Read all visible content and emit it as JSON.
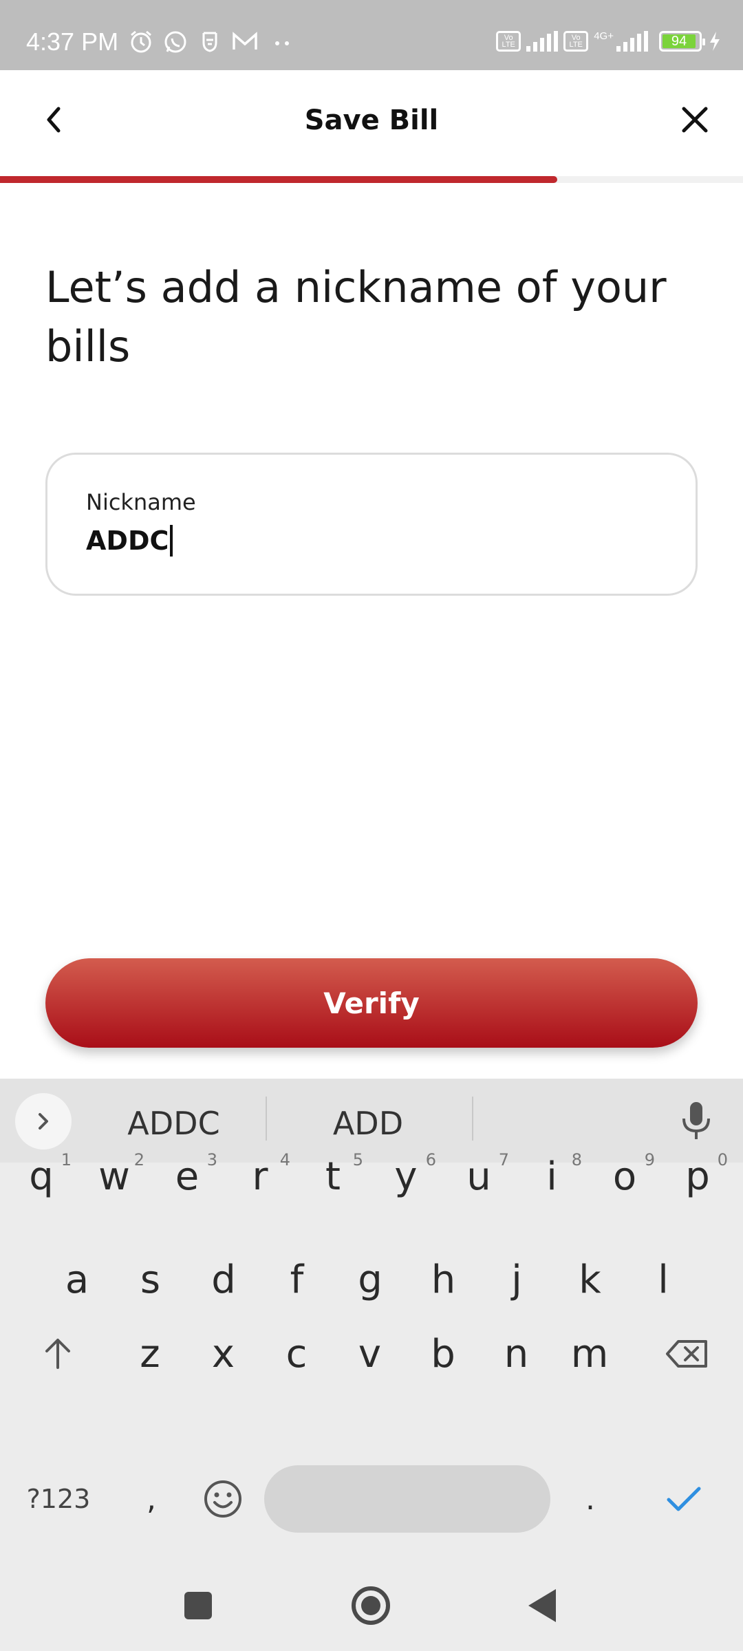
{
  "status_bar": {
    "time": "4:37 PM",
    "left_icons": [
      "alarm-icon",
      "whatsapp-icon",
      "app-icon",
      "gmail-icon",
      "more-dots-icon"
    ],
    "volte_label": "Vo LTE",
    "network_tag": "4G+",
    "battery_level": "94"
  },
  "header": {
    "title": "Save Bill",
    "back_icon": "chevron-left-icon",
    "close_icon": "close-icon",
    "progress_fraction": 0.75
  },
  "content": {
    "heading": "Let’s add a nickname of your bills",
    "nickname_field": {
      "label": "Nickname",
      "value": "ADDC"
    },
    "verify_label": "Verify"
  },
  "keyboard": {
    "suggestions": [
      "ADDC",
      "ADD"
    ],
    "row1": [
      {
        "k": "q",
        "n": "1"
      },
      {
        "k": "w",
        "n": "2"
      },
      {
        "k": "e",
        "n": "3"
      },
      {
        "k": "r",
        "n": "4"
      },
      {
        "k": "t",
        "n": "5"
      },
      {
        "k": "y",
        "n": "6"
      },
      {
        "k": "u",
        "n": "7"
      },
      {
        "k": "i",
        "n": "8"
      },
      {
        "k": "o",
        "n": "9"
      },
      {
        "k": "p",
        "n": "0"
      }
    ],
    "row2": [
      "a",
      "s",
      "d",
      "f",
      "g",
      "h",
      "j",
      "k",
      "l"
    ],
    "row3": [
      "z",
      "x",
      "c",
      "v",
      "b",
      "n",
      "m"
    ],
    "symbols_label": "?123",
    "comma": ",",
    "period": ".",
    "accent_color": "#2f8fe0"
  }
}
